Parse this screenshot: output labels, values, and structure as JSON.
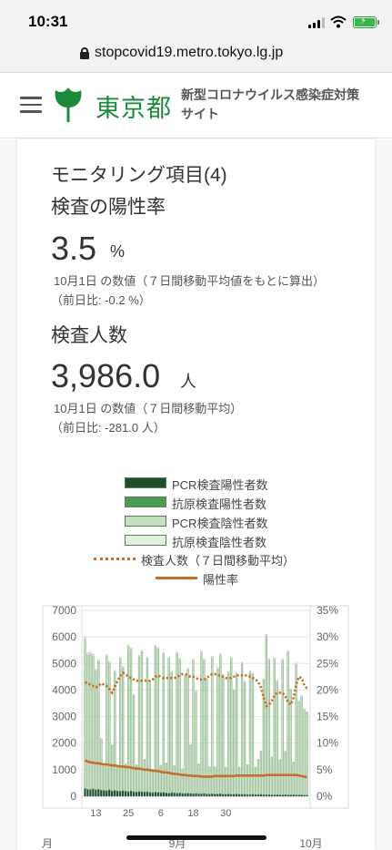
{
  "status": {
    "time": "10:31"
  },
  "browser": {
    "url": "stopcovid19.metro.tokyo.lg.jp"
  },
  "header": {
    "logo_text": "東京都",
    "site_title": "新型コロナウイルス感染症対策サイト"
  },
  "card": {
    "monitoring_title": "モニタリング項目(4)",
    "positivity": {
      "title": "検査の陽性率",
      "value": "3.5",
      "unit": "%",
      "note": "10月1日 の数値（７日間移動平均値をもとに算出）",
      "diff": "（前日比: -0.2 %）"
    },
    "tests": {
      "title": "検査人数",
      "value": "3,986.0",
      "unit": "人",
      "note": "10月1日 の数値（７日間移動平均）",
      "diff": "（前日比: -281.0 人）"
    }
  },
  "legend": [
    {
      "label": "PCR検査陽性者数",
      "color": "#1f4d2e"
    },
    {
      "label": "抗原検査陽性者数",
      "color": "#4a9c52"
    },
    {
      "label": "PCR検査陰性者数",
      "color": "#c3dfc0"
    },
    {
      "label": "抗原検査陰性者数",
      "color": "#e3f0e0"
    },
    {
      "label": "検査人数（７日間移動平均）",
      "color": "#c2702a"
    },
    {
      "label": "陽性率",
      "color": "#c2702a"
    }
  ],
  "chart_data": {
    "type": "bar",
    "left_axis": {
      "ticks": [
        "0",
        "1000",
        "2000",
        "3000",
        "4000",
        "5000",
        "6000",
        "7000"
      ],
      "ylim": [
        0,
        7000
      ]
    },
    "right_axis": {
      "ticks": [
        "0%",
        "5%",
        "10%",
        "15%",
        "20%",
        "25%",
        "30%",
        "35%"
      ],
      "ylim": [
        0,
        35
      ]
    },
    "x_day_labels": [
      "13",
      "25",
      "6",
      "18",
      "30"
    ],
    "x_month_labels": [
      "月",
      "9月",
      "10月"
    ],
    "start_date": "2020-08-09",
    "series": [
      {
        "name": "PCR検査陽性者数",
        "values": [
          280,
          250,
          240,
          260,
          230,
          250,
          220,
          210,
          200,
          230,
          190,
          210,
          190,
          180,
          200,
          180,
          170,
          190,
          160,
          150,
          170,
          160,
          150,
          160,
          140,
          130,
          150,
          140,
          130,
          140,
          120,
          110,
          130,
          120,
          110,
          120,
          100,
          100,
          110,
          100,
          90,
          100,
          90,
          90,
          100,
          80,
          80,
          90,
          80,
          80,
          90,
          70,
          70,
          80,
          70,
          70,
          80,
          70,
          70,
          70,
          60,
          60,
          70,
          60,
          60,
          70,
          60,
          60,
          60,
          50,
          50,
          60,
          50,
          50,
          60,
          50,
          50,
          60,
          50,
          50,
          50,
          40,
          40
        ]
      },
      {
        "name": "抗原検査陽性者数",
        "values": [
          20,
          18,
          18,
          20,
          16,
          18,
          16,
          15,
          15,
          17,
          14,
          15,
          14,
          13,
          15,
          13,
          12,
          14,
          12,
          11,
          12,
          12,
          11,
          12,
          10,
          10,
          11,
          10,
          10,
          10,
          9,
          8,
          9,
          9,
          8,
          9,
          8,
          7,
          8,
          7,
          7,
          8,
          7,
          7,
          7,
          6,
          6,
          7,
          6,
          6,
          6,
          5,
          5,
          6,
          5,
          5,
          6,
          5,
          5,
          5,
          4,
          4,
          5,
          4,
          4,
          5,
          4,
          4,
          4,
          4,
          4,
          4,
          4,
          4,
          4,
          3,
          3,
          4,
          3,
          3,
          3,
          3,
          3
        ]
      },
      {
        "name": "PCR検査陰性者数",
        "values": [
          5600,
          5050,
          5100,
          5000,
          4480,
          4800,
          1900,
          900,
          5050,
          4760,
          1700,
          4450,
          900,
          4980,
          4600,
          1000,
          5450,
          5300,
          3600,
          1000,
          5050,
          5250,
          1200,
          5000,
          4100,
          850,
          5450,
          5380,
          1000,
          5200,
          1100,
          5050,
          4500,
          1000,
          5250,
          5000,
          900,
          4400,
          4650,
          1800,
          5000,
          3800,
          1100,
          5300,
          5000,
          4300,
          1000,
          5100,
          1000,
          4700,
          5200,
          4450,
          1000,
          4550,
          5100,
          3900,
          4500,
          1000,
          4900,
          4200,
          1100,
          4600,
          4500,
          1000,
          1300,
          1600,
          4300,
          5950,
          5050,
          1400,
          5100,
          4250,
          1300,
          5050,
          1600,
          5350,
          3950,
          1200,
          4900,
          3500,
          3700,
          3200,
          3100
        ]
      },
      {
        "name": "抗原検査陰性者数",
        "values": [
          80,
          75,
          75,
          70,
          70,
          70,
          40,
          30,
          70,
          70,
          40,
          65,
          30,
          70,
          65,
          30,
          75,
          70,
          55,
          30,
          70,
          72,
          30,
          70,
          60,
          28,
          75,
          72,
          30,
          70,
          30,
          68,
          62,
          30,
          70,
          68,
          28,
          60,
          62,
          40,
          68,
          55,
          30,
          70,
          68,
          60,
          30,
          68,
          30,
          64,
          70,
          62,
          30,
          62,
          68,
          55,
          62,
          30,
          66,
          58,
          30,
          62,
          62,
          30,
          32,
          36,
          58,
          78,
          68,
          34,
          68,
          58,
          32,
          68,
          36,
          70,
          55,
          32,
          65,
          50,
          52,
          46,
          45
        ]
      },
      {
        "name": "検査人数（７日間移動平均）",
        "values": [
          4300,
          4250,
          4200,
          4150,
          4100,
          4150,
          4250,
          4200,
          4150,
          4050,
          3900,
          4100,
          4350,
          4500,
          4650,
          4600,
          4500,
          4450,
          4400,
          4350,
          4350,
          4350,
          4350,
          4350,
          4350,
          4400,
          4500,
          4550,
          4500,
          4450,
          4450,
          4450,
          4450,
          4450,
          4500,
          4550,
          4600,
          4600,
          4550,
          4500,
          4500,
          4450,
          4400,
          4400,
          4400,
          4450,
          4550,
          4600,
          4600,
          4550,
          4550,
          4500,
          4450,
          4450,
          4450,
          4500,
          4550,
          4550,
          4550,
          4550,
          4550,
          4500,
          4450,
          4400,
          4300,
          4100,
          3700,
          3400,
          3450,
          3600,
          3800,
          3900,
          3900,
          3900,
          3750,
          3550,
          3450,
          3700,
          4200,
          4500,
          4450,
          4200,
          4050
        ]
      },
      {
        "name": "陽性率",
        "values": [
          6.8,
          6.5,
          6.4,
          6.3,
          6.2,
          6.2,
          6.1,
          6.0,
          6.0,
          5.9,
          5.8,
          5.8,
          5.7,
          5.6,
          5.6,
          5.5,
          5.5,
          5.4,
          5.3,
          5.2,
          5.2,
          5.1,
          5.0,
          5.0,
          4.9,
          4.8,
          4.8,
          4.7,
          4.6,
          4.5,
          4.5,
          4.4,
          4.3,
          4.2,
          4.2,
          4.1,
          4.0,
          4.0,
          3.9,
          3.9,
          3.8,
          3.8,
          3.8,
          3.7,
          3.7,
          3.7,
          3.7,
          3.7,
          3.8,
          3.8,
          3.8,
          3.8,
          3.8,
          3.8,
          3.8,
          3.8,
          3.9,
          3.9,
          3.9,
          3.9,
          3.9,
          3.9,
          3.9,
          3.9,
          3.9,
          3.9,
          3.9,
          4.0,
          4.0,
          4.0,
          4.0,
          4.0,
          4.0,
          4.0,
          4.0,
          4.0,
          4.0,
          4.0,
          4.0,
          3.9,
          3.8,
          3.7,
          3.6
        ]
      }
    ]
  }
}
